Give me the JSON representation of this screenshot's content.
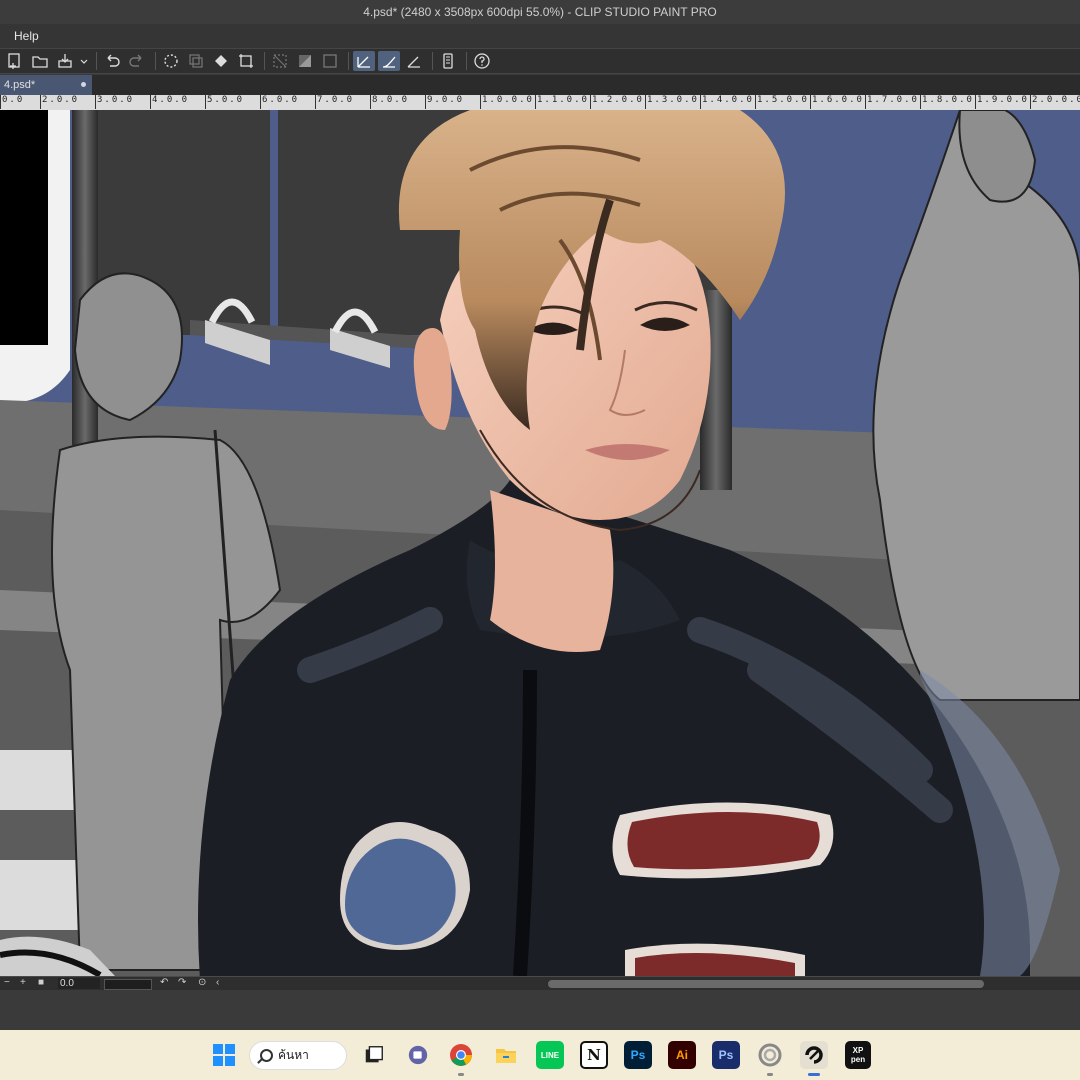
{
  "window": {
    "title": "4.psd* (2480 x 3508px 600dpi 55.0%)  - CLIP STUDIO PAINT PRO"
  },
  "menu": {
    "items": [
      "Help"
    ]
  },
  "tab": {
    "label": "4.psd*"
  },
  "ruler": {
    "ticks": [
      "0.0",
      "2.0.0",
      "3.0.0",
      "4.0.0",
      "5.0.0",
      "6.0.0",
      "7.0.0",
      "8.0.0",
      "9.0.0",
      "1.0.0.0",
      "1.1.0.0",
      "1.2.0.0",
      "1.3.0.0",
      "1.4.0.0",
      "1.5.0.0",
      "1.6.0.0",
      "1.7.0.0",
      "1.8.0.0",
      "1.9.0.0",
      "2.0.0.0"
    ]
  },
  "statusbar": {
    "zoom_value": "0.0"
  },
  "taskbar": {
    "search_label": "ค้นหา",
    "apps": [
      {
        "name": "Windows Start",
        "glyph": ""
      },
      {
        "name": "Task View",
        "glyph": ""
      },
      {
        "name": "Teams",
        "glyph": ""
      },
      {
        "name": "Chrome",
        "glyph": ""
      },
      {
        "name": "File Explorer",
        "glyph": ""
      },
      {
        "name": "LINE",
        "glyph": "LINE"
      },
      {
        "name": "Notion",
        "glyph": "N"
      },
      {
        "name": "Photoshop",
        "glyph": "Ps"
      },
      {
        "name": "Illustrator",
        "glyph": "Ai"
      },
      {
        "name": "Photoshop 2",
        "glyph": "Ps"
      },
      {
        "name": "Clip Studio",
        "glyph": ""
      },
      {
        "name": "Clip Studio Paint",
        "glyph": ""
      },
      {
        "name": "XP-Pen",
        "glyph": "XP pen"
      }
    ]
  },
  "colors": {
    "accent": "#51627f",
    "tab": "#4a5773",
    "wall_blue": "#4e5d8a",
    "taskbar_bg": "#f3ecd6"
  }
}
